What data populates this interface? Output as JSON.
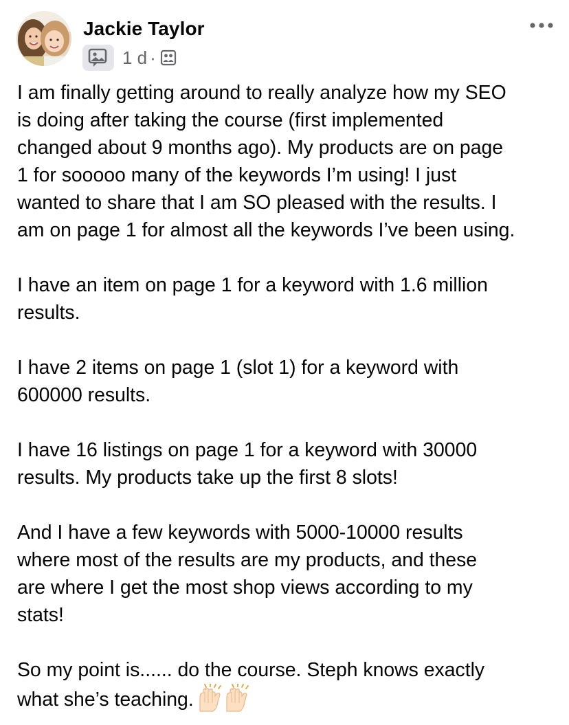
{
  "post": {
    "author": "Jackie Taylor",
    "time": "1 d",
    "separator": "·",
    "icons": {
      "avatar": "profile-photo",
      "badge": "photo-comment-badge-icon",
      "audience": "group-members-icon",
      "more": "more-options-icon"
    },
    "paragraphs": [
      {
        "lines": [
          "I am finally getting around to really analyze how my SEO",
          "is doing after taking the course (first implemented",
          "changed about 9 months ago). My products are on page",
          "1 for sooooo many of the keywords I’m using! I just",
          "wanted to share that I am SO pleased with the results. I",
          "am on page 1 for almost all the keywords I’ve been using."
        ]
      },
      {
        "lines": [
          "I have an item on page 1 for a keyword with 1.6 million",
          "results."
        ]
      },
      {
        "lines": [
          "I have 2 items on page 1 (slot 1) for a keyword with",
          "600000 results."
        ]
      },
      {
        "lines": [
          "I have 16 listings on page 1 for a keyword with 30000",
          "results. My products take up the first 8 slots!"
        ]
      },
      {
        "lines": [
          "And I have a few keywords with 5000-10000 results",
          "where most of the results are my products, and these",
          "are where I get the most shop views according to my",
          "stats!"
        ]
      },
      {
        "lines": [
          "So my point is...... do the course. Steph knows exactly",
          "what she’s teaching."
        ],
        "trailing_emoji": "raising-hands-emoji"
      }
    ]
  }
}
